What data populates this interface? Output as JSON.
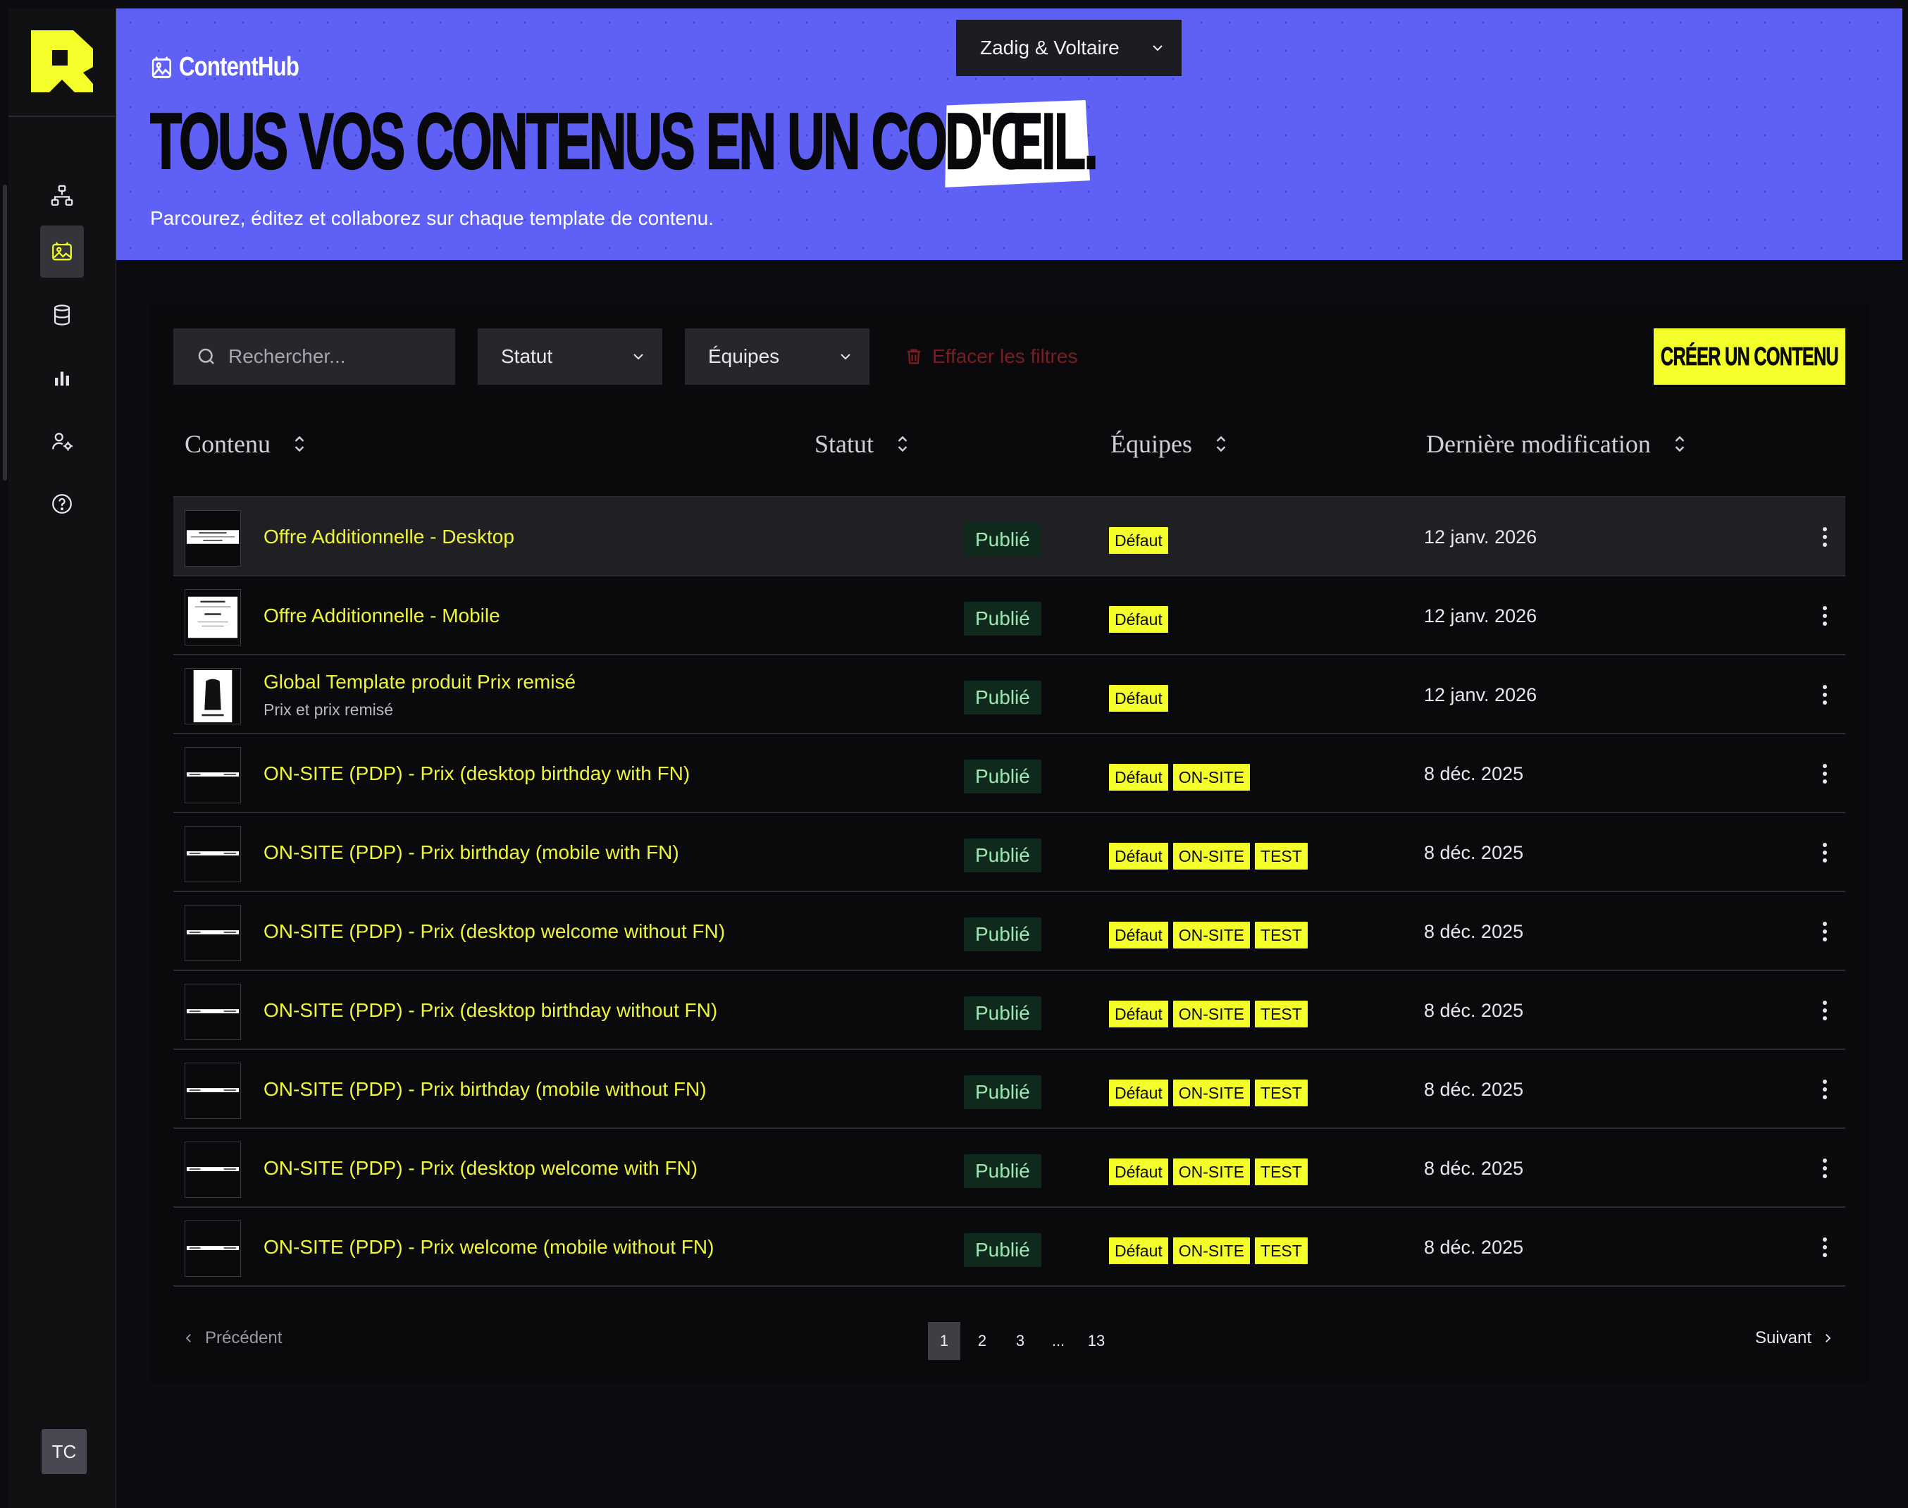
{
  "app": {
    "brand": "ContentHub",
    "client_selector": "Zadig & Voltaire",
    "user_initials": "TC",
    "accent_color": "#f4ff2a",
    "hero_color": "#5f61f6"
  },
  "sidebar": {
    "items": [
      {
        "icon": "structure-icon",
        "active": false
      },
      {
        "icon": "content-icon",
        "active": true
      },
      {
        "icon": "database-icon",
        "active": false
      },
      {
        "icon": "analytics-icon",
        "active": false
      },
      {
        "icon": "user-settings-icon",
        "active": false
      },
      {
        "icon": "help-icon",
        "active": false
      }
    ]
  },
  "hero": {
    "headline_main": "TOUS VOS CONTENUS EN UN COUP",
    "headline_accent": "D'ŒIL.",
    "subtitle": "Parcourez, éditez et collaborez sur chaque template de contenu."
  },
  "filters": {
    "search_placeholder": "Rechercher...",
    "status_label": "Statut",
    "teams_label": "Équipes",
    "clear_label": "Effacer les filtres",
    "create_label": "CRÉER UN CONTENU"
  },
  "table": {
    "columns": [
      "Contenu",
      "Statut",
      "Équipes",
      "Dernière modification"
    ],
    "rows": [
      {
        "title": "Offre Additionnelle - Desktop",
        "subtitle": "",
        "status": "Publié",
        "teams": [
          "Défaut"
        ],
        "date": "12 janv. 2026",
        "thumb": "banner"
      },
      {
        "title": "Offre Additionnelle - Mobile",
        "subtitle": "",
        "status": "Publié",
        "teams": [
          "Défaut"
        ],
        "date": "12 janv. 2026",
        "thumb": "mobile"
      },
      {
        "title": "Global Template produit Prix remisé",
        "subtitle": "Prix et prix remisé",
        "status": "Publié",
        "teams": [
          "Défaut"
        ],
        "date": "12 janv. 2026",
        "thumb": "product"
      },
      {
        "title": "ON-SITE (PDP) - Prix (desktop birthday with FN)",
        "subtitle": "",
        "status": "Publié",
        "teams": [
          "Défaut",
          "ON-SITE"
        ],
        "date": "8 déc. 2025",
        "thumb": "line"
      },
      {
        "title": "ON-SITE (PDP) - Prix birthday (mobile with FN)",
        "subtitle": "",
        "status": "Publié",
        "teams": [
          "Défaut",
          "ON-SITE",
          "TEST"
        ],
        "date": "8 déc. 2025",
        "thumb": "line"
      },
      {
        "title": "ON-SITE (PDP) - Prix (desktop welcome without FN)",
        "subtitle": "",
        "status": "Publié",
        "teams": [
          "Défaut",
          "ON-SITE",
          "TEST"
        ],
        "date": "8 déc. 2025",
        "thumb": "line"
      },
      {
        "title": "ON-SITE (PDP) - Prix (desktop birthday without FN)",
        "subtitle": "",
        "status": "Publié",
        "teams": [
          "Défaut",
          "ON-SITE",
          "TEST"
        ],
        "date": "8 déc. 2025",
        "thumb": "line"
      },
      {
        "title": "ON-SITE (PDP) - Prix birthday (mobile without FN)",
        "subtitle": "",
        "status": "Publié",
        "teams": [
          "Défaut",
          "ON-SITE",
          "TEST"
        ],
        "date": "8 déc. 2025",
        "thumb": "line"
      },
      {
        "title": "ON-SITE (PDP) - Prix (desktop welcome with FN)",
        "subtitle": "",
        "status": "Publié",
        "teams": [
          "Défaut",
          "ON-SITE",
          "TEST"
        ],
        "date": "8 déc. 2025",
        "thumb": "line"
      },
      {
        "title": "ON-SITE (PDP) - Prix welcome (mobile without FN)",
        "subtitle": "",
        "status": "Publié",
        "teams": [
          "Défaut",
          "ON-SITE",
          "TEST"
        ],
        "date": "8 déc. 2025",
        "thumb": "line"
      }
    ]
  },
  "pagination": {
    "prev_label": "Précédent",
    "next_label": "Suivant",
    "pages": [
      "1",
      "2",
      "3",
      "...",
      "13"
    ],
    "current": "1"
  }
}
